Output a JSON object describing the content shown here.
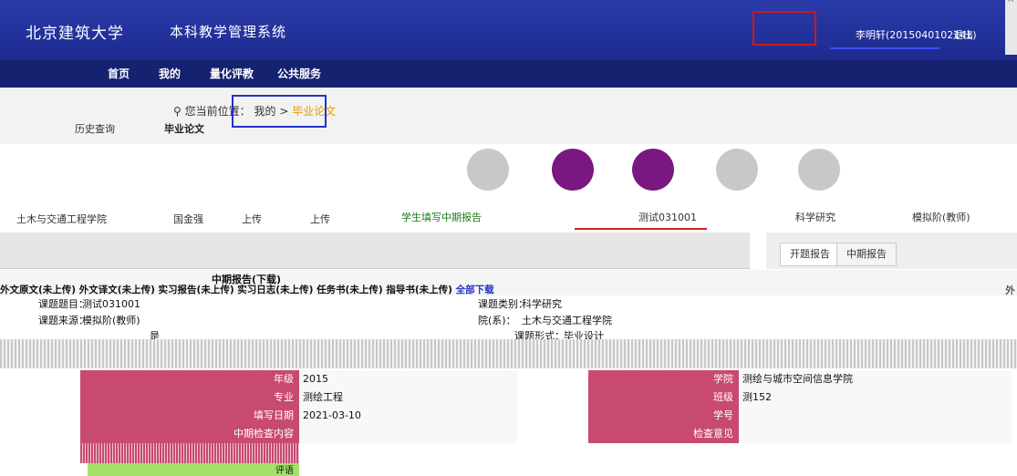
{
  "header": {
    "university": "北京建筑大学",
    "system": "本科教学管理系统",
    "user": "李明轩(2015040102141)",
    "logout": "退出"
  },
  "nav": [
    "首页",
    "我的",
    "量化评教",
    "公共服务"
  ],
  "history": "历史查询",
  "breadcrumb": {
    "prefix": "您当前位置：",
    "mine": "我的",
    "sep": " > ",
    "current": "毕业论文"
  },
  "paper_title": "毕业论文",
  "step_active": "中期报告",
  "info": {
    "college": "土木与交通工程学院",
    "mentor": "国金强",
    "upload1": "上传",
    "upload2": "上传",
    "fill_report": "学生填写中期报告",
    "title_item": "测试031001",
    "category": "科学研究",
    "review": "模拟阶(教师)"
  },
  "tabs": [
    "开题报告",
    "中期报告"
  ],
  "doc": {
    "header": "中期报告(下载)",
    "files": [
      "外文原文(未上传)",
      "外文译文(未上传)",
      "实习报告(未上传)",
      "实习日志(未上传)",
      "任务书(未上传)",
      "指导书(未上传)"
    ],
    "download_all": "全部下载"
  },
  "fields": {
    "topic_label": "课题题目：",
    "topic": "测试031001",
    "category_label": "课题类别：",
    "category": "科学研究",
    "source_label": "课题来源：",
    "source": "模拟阶(教师)",
    "college_label": "院(系)：",
    "college": "土木与交通工程学院",
    "form_label": "课题形式：",
    "form": "毕业设计",
    "yes_label": "是"
  },
  "table": [
    {
      "l": "年级",
      "v": "2015",
      "r": "学院",
      "rv": "测绘与城市空间信息学院"
    },
    {
      "l": "专业",
      "v": "测绘工程",
      "r": "班级",
      "rv": "测152"
    },
    {
      "l": "填写日期",
      "v": "2021-03-10",
      "r": "学号",
      "rv": ""
    },
    {
      "l": "中期检查内容",
      "v": "",
      "r": "检查意见",
      "rv": ""
    }
  ],
  "review_label": "评语",
  "side": "外"
}
